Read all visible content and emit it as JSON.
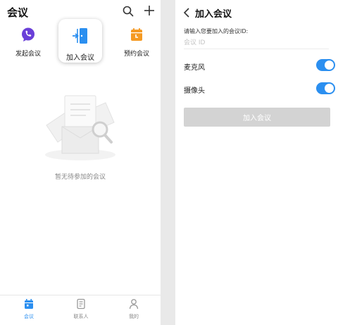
{
  "left": {
    "header": {
      "title": "会议",
      "search_icon": "search-icon",
      "add_icon": "plus-icon"
    },
    "actions": {
      "start": {
        "label": "发起会议",
        "icon": "phone-bubble-icon",
        "color": "#6a3fd8"
      },
      "join": {
        "label": "加入会议",
        "icon": "enter-door-icon",
        "color": "#2b8ff0"
      },
      "schedule": {
        "label": "预约会议",
        "icon": "calendar-icon",
        "color": "#f59a23"
      }
    },
    "empty_state": {
      "text": "暂无待参加的会议"
    },
    "tabbar": {
      "items": [
        {
          "label": "会议",
          "icon": "calendar-tab-icon",
          "active": true
        },
        {
          "label": "联系人",
          "icon": "contacts-icon",
          "active": false
        },
        {
          "label": "我的",
          "icon": "person-icon",
          "active": false
        }
      ]
    }
  },
  "right": {
    "header": {
      "title": "加入会议",
      "back_icon": "back-chevron-icon"
    },
    "meeting_id": {
      "label": "请输入您要加入的会议ID:",
      "placeholder": "会议 ID",
      "value": ""
    },
    "microphone": {
      "label": "麦克风",
      "on": true
    },
    "camera": {
      "label": "摄像头",
      "on": true
    },
    "join_button": {
      "label": "加入会议",
      "enabled": false
    }
  },
  "colors": {
    "accent": "#2b8ff0",
    "disabled_button": "#d3d3d3"
  }
}
